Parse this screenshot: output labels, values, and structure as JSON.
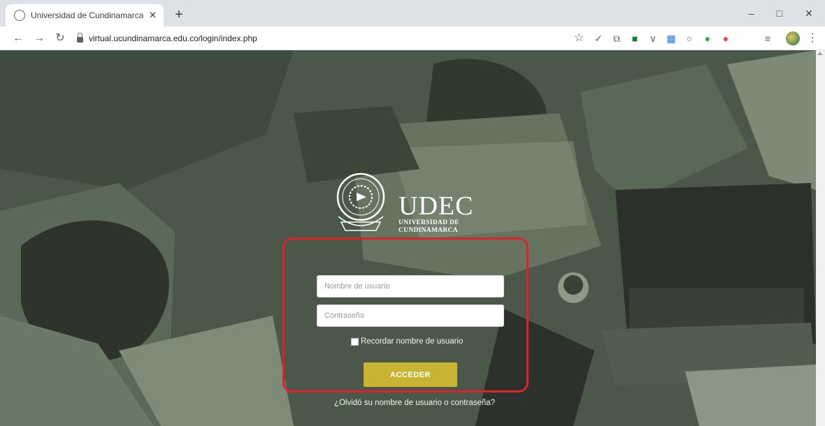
{
  "browser": {
    "tab_title": "Universidad de Cundinamarca •",
    "tab_close": "✕",
    "new_tab": "+",
    "window_minimize": "–",
    "window_maximize": "□",
    "window_close": "✕",
    "back": "←",
    "forward": "→",
    "reload": "↻",
    "url": "virtual.ucundinamarca.edu.co/login/index.php",
    "bookmark": "☆",
    "menu": "⋮"
  },
  "extensions": [
    {
      "icon": "checkmark-icon",
      "glyph": "✓",
      "color": "#5f6368"
    },
    {
      "icon": "copy-icon",
      "glyph": "⧉",
      "color": "#5f6368"
    },
    {
      "icon": "green-square-icon",
      "glyph": "■",
      "color": "#188038"
    },
    {
      "icon": "pocket-icon",
      "glyph": "∨",
      "color": "#5f6368"
    },
    {
      "icon": "calendar-icon",
      "glyph": "▦",
      "color": "#1a73e8"
    },
    {
      "icon": "circle-icon",
      "glyph": "○",
      "color": "#5f6368"
    },
    {
      "icon": "multicolor-icon",
      "glyph": "●",
      "color": "#34a853"
    },
    {
      "icon": "red-circle-icon",
      "glyph": "●",
      "color": "#ea4335"
    },
    {
      "icon": "reading-list-icon",
      "glyph": "≡",
      "color": "#5f6368"
    }
  ],
  "logo": {
    "brand": "UDEC",
    "line1": "UNIVERSIDAD DE",
    "line2": "CUNDINAMARCA"
  },
  "login": {
    "username_placeholder": "Nombre de usuario",
    "password_placeholder": "Contraseña",
    "remember_label": "Recordar nombre de usuario",
    "submit_label": "ACCEDER",
    "forgot_link": "¿Olvidó su nombre de usuario o contraseña?"
  },
  "colors": {
    "overlay": "#4d5a4c",
    "button": "#c8b432",
    "highlight": "#e0202a"
  }
}
